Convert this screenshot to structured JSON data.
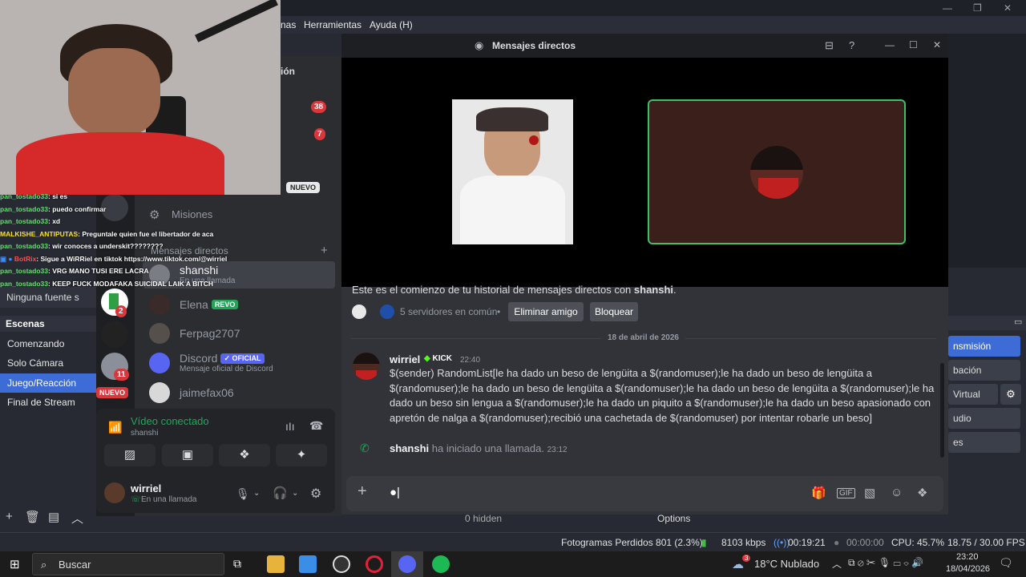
{
  "obs": {
    "menu": [
      "nas",
      "Herramientas",
      "Ayuda (H)"
    ],
    "sources_empty": "Ninguna fuente s",
    "scenes_title": "Escenas",
    "scenes": [
      "Comenzando",
      "Solo Cámara",
      "Juego/Reacción",
      "Final de Stream"
    ],
    "selected_scene": "Juego/Reacción",
    "controls": [
      "nsmisión",
      "bación",
      "Virtual",
      "udio",
      "es"
    ],
    "mixer_partial": [
      "0 hidden",
      "Options"
    ],
    "status": {
      "dropped_frames": "Fotogramas Perdidos 801 (2.3%)",
      "bitrate": "8103 kbps",
      "live_time": "00:19:21",
      "rec_time": "00:00:00",
      "cpu": "CPU: 45.7%",
      "fps": "18.75 / 30.00 FPS"
    }
  },
  "discord": {
    "window_title": "Mensajes directos",
    "partial_tab": "sación",
    "guild_badges": [
      "38",
      "7",
      "2",
      "11"
    ],
    "nuevo_badge": "NUEVO",
    "missions_label": "Misiones",
    "dm_header": "Mensajes directos",
    "dms": [
      {
        "name": "shanshi",
        "sub": "En una llamada",
        "tag": ""
      },
      {
        "name": "Elena",
        "sub": "",
        "tag": "REVO"
      },
      {
        "name": "Ferpag2707",
        "sub": "",
        "tag": ""
      },
      {
        "name": "Discord",
        "sub": "Mensaje oficial de Discord",
        "tag": "✓ OFICIAL"
      },
      {
        "name": "jaimefax06",
        "sub": "",
        "tag": ""
      }
    ],
    "voice": {
      "status": "Vídeo conectado",
      "channel": "shanshi"
    },
    "user": {
      "name": "wirriel",
      "status": "En una llamada"
    },
    "intro": "Este es el comienzo de tu historial de mensajes directos con ",
    "intro_user": "shanshi",
    "mutual_servers": "5 servidores en común",
    "remove_friend": "Eliminar amigo",
    "block": "Bloquear",
    "date_divider": "18 de abril de 2026",
    "message": {
      "author": "wirriel",
      "tag": "KICK",
      "time": "22:40",
      "lines": [
        "$(sender)  RandomList[le ha dado un beso de lengüita a $(randomuser);le ha dado un beso de lengüita a",
        "$(randomuser);le ha dado un beso de lengüita a $(randomuser);le ha dado un beso de lengüita a $(randomuser);le ha",
        "dado un beso sin lengua a $(randomuser);le ha dado un piquito a $(randomuser);le ha dado un beso apasionado con",
        "apretón de nalga a $(randomuser);recibió una cachetada de $(randomuser) por intentar robarle un beso]"
      ]
    },
    "call_event": {
      "user": "shanshi",
      "text": "ha iniciado una llamada.",
      "time": "23:12"
    },
    "composer_value": "●|"
  },
  "stream_chat": [
    {
      "user": "pan_tostado33",
      "msg": ": si es"
    },
    {
      "user": "pan_tostado33",
      "msg": ": puedo confirmar"
    },
    {
      "user": "pan_tostado33",
      "msg": ": xd"
    },
    {
      "user": "MALKISHE_ANTIPUTAS",
      "msg": ": Preguntale quien fue el libertador de aca"
    },
    {
      "user": "pan_tostado33",
      "msg": ": wir conoces a underskit????????"
    },
    {
      "user": "BotRix",
      "msg": ":    Sigue a WiRRiel en tiktok https://www.tiktok.com/@wirriel"
    },
    {
      "user": "pan_tostado33",
      "msg": ": VRG MANO TUSI ERE LACRA"
    },
    {
      "user": "pan_tostado33",
      "msg": ": KEEP FUCK MODAFAKA SUICIDAL LAIK A BITCH"
    }
  ],
  "taskbar": {
    "search": "Buscar",
    "weather": "18°C  Nublado",
    "weather_badge": "3",
    "time": "23:20",
    "date": "18/04/2026"
  },
  "colors": {
    "discord_green": "#3fbf6a",
    "obs_blue": "#3d6cd6",
    "badge_red": "#da373c",
    "kick_green": "#53fc18"
  }
}
